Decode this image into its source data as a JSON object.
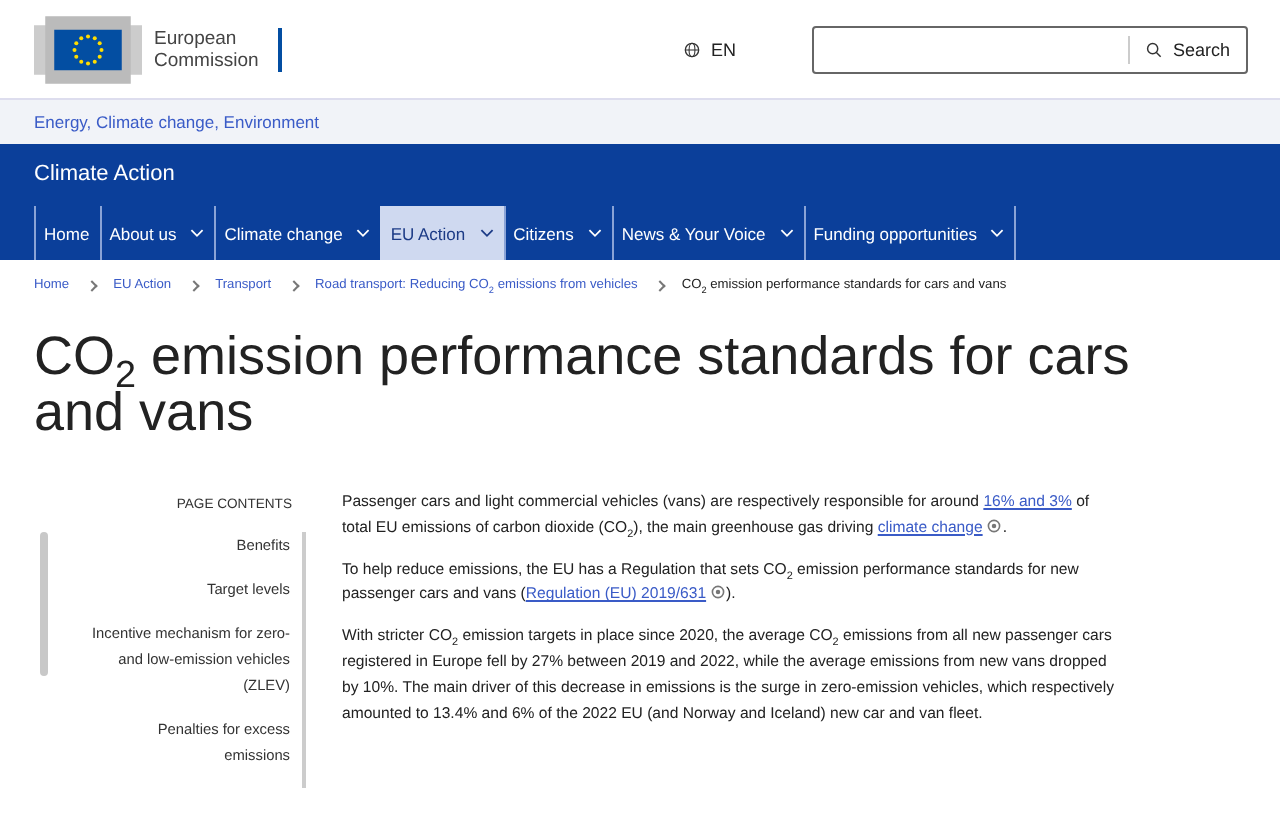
{
  "header": {
    "logo_text": [
      "European",
      "Commission"
    ],
    "language": "EN",
    "search": {
      "button": "Search"
    }
  },
  "site_links": "Energy, Climate change, Environment",
  "site_title": "Climate Action",
  "nav": [
    {
      "label": "Home",
      "has_menu": false,
      "selected": false
    },
    {
      "label": "About us",
      "has_menu": true,
      "selected": false
    },
    {
      "label": "Climate change",
      "has_menu": true,
      "selected": false
    },
    {
      "label": "EU Action",
      "has_menu": true,
      "selected": true
    },
    {
      "label": "Citizens",
      "has_menu": true,
      "selected": false
    },
    {
      "label": "News & Your Voice",
      "has_menu": true,
      "selected": false
    },
    {
      "label": "Funding opportunities",
      "has_menu": true,
      "selected": false
    }
  ],
  "breadcrumb": [
    {
      "label": "Home",
      "current": false
    },
    {
      "label": "EU Action",
      "current": false
    },
    {
      "label": "Transport",
      "current": false
    },
    {
      "label": "Road transport: Reducing CO$_{2}$ emissions from vehicles",
      "current": false
    },
    {
      "label": "CO$_{2}$ emission performance standards for cars and vans",
      "current": true
    }
  ],
  "page_title": "CO$_{2}$ emission performance standards for cars and vans",
  "page_contents": {
    "heading": "PAGE CONTENTS",
    "items": [
      "Benefits",
      "Target levels",
      "Incentive mechanism for zero- and low-emission vehicles (ZLEV)",
      "Penalties for excess emissions"
    ]
  },
  "paragraphs": [
    [
      {
        "kind": "text",
        "text": "Passenger cars and light commercial vehicles (vans) are respectively responsible for around "
      },
      {
        "kind": "link",
        "text": "16% and 3%"
      },
      {
        "kind": "text",
        "text": " of total EU emissions of carbon dioxide (CO$_{2}$), the main greenhouse gas driving "
      },
      {
        "kind": "link",
        "text": "climate change",
        "external": true
      },
      {
        "kind": "text",
        "text": "."
      }
    ],
    [
      {
        "kind": "text",
        "text": "To help reduce emissions, the EU has a Regulation that sets CO$_{2}$ emission performance standards for new passenger cars and vans ("
      },
      {
        "kind": "link",
        "text": "Regulation (EU) 2019/631",
        "external": true
      },
      {
        "kind": "text",
        "text": ")."
      }
    ],
    [
      {
        "kind": "text",
        "text": "With stricter CO$_{2}$ emission targets in place since 2020, the average CO$_{2}$ emissions from all new passenger cars registered in Europe fell by 27% between 2019 and 2022, while the average emissions from new vans dropped by 10%. The main driver of this decrease in emissions is the surge in zero-emission vehicles, which respectively amounted to 13.4% and 6% of the 2022 EU (and Norway and Iceland) new car and van fleet."
      }
    ]
  ]
}
